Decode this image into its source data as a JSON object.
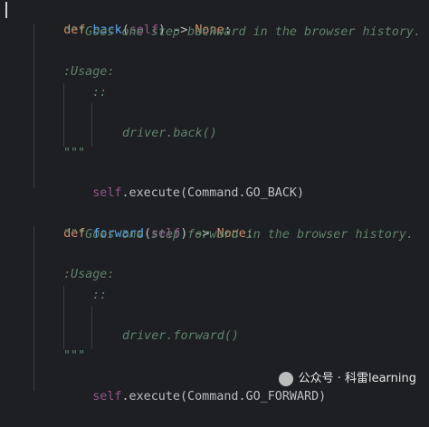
{
  "code": {
    "def_kw": "def",
    "back_name": "back",
    "forward_name": "forward",
    "self_param": "self",
    "arrow_none": ") -> ",
    "none_kw": "None",
    "colon": ":",
    "open_paren": "(",
    "back_doc": "\"\"\"Goes one step backward in the browser history.",
    "forward_doc": "\"\"\"Goes one step forward in the browser history.",
    "usage": ":Usage:",
    "double_colon": "::",
    "back_example": "driver.back()",
    "forward_example": "driver.forward()",
    "doc_close": "\"\"\"",
    "self_kw": "self",
    "back_exec": ".execute(Command.GO_BACK)",
    "forward_exec": ".execute(Command.GO_FORWARD)"
  },
  "watermark": {
    "text": "公众号 · 科雷learning"
  }
}
